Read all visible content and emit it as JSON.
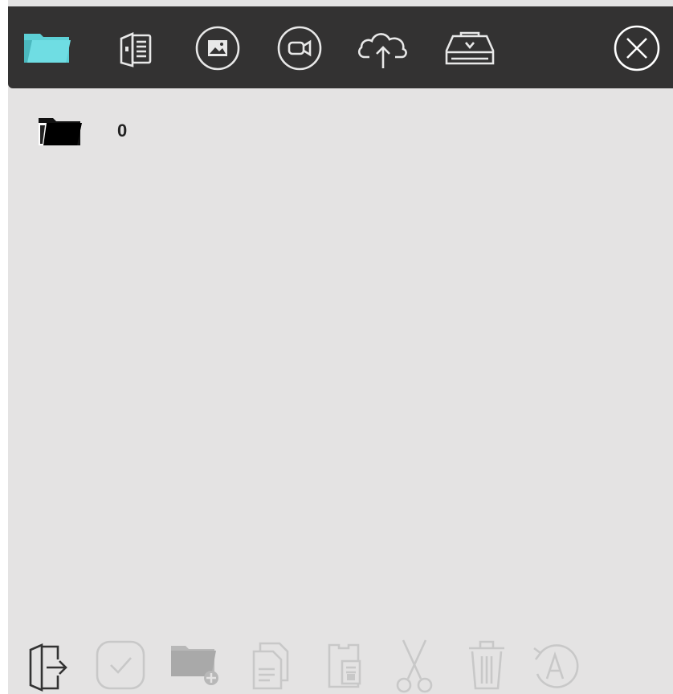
{
  "toolbar": {
    "buttons": [
      {
        "icon": "folder-icon",
        "active": true
      },
      {
        "icon": "document-reader-icon"
      },
      {
        "icon": "image-icon"
      },
      {
        "icon": "video-icon"
      },
      {
        "icon": "cloud-upload-icon"
      },
      {
        "icon": "usb-drive-icon"
      },
      {
        "icon": "close-icon"
      }
    ],
    "accent_color": "#5dd0d6"
  },
  "file_list": {
    "items": [
      {
        "name": "0",
        "icon": "folder-icon"
      }
    ]
  },
  "bottom_bar": {
    "buttons": [
      {
        "icon": "exit-icon",
        "enabled": true
      },
      {
        "icon": "select-check-icon",
        "enabled": false
      },
      {
        "icon": "new-folder-icon",
        "enabled": false
      },
      {
        "icon": "copy-icon",
        "enabled": false
      },
      {
        "icon": "paste-icon",
        "enabled": false
      },
      {
        "icon": "cut-icon",
        "enabled": false
      },
      {
        "icon": "delete-icon",
        "enabled": false
      },
      {
        "icon": "rename-icon",
        "enabled": false
      }
    ]
  }
}
